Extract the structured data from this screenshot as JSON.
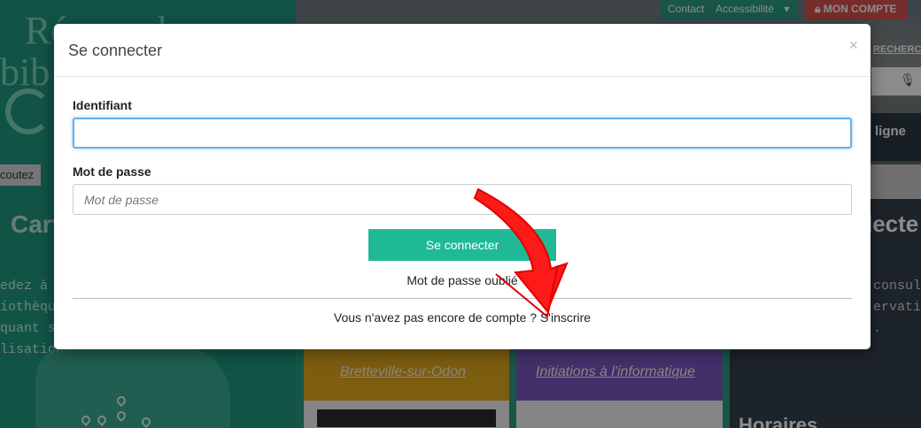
{
  "background": {
    "logo_line1": "Réseau des",
    "logo_line2": "bib",
    "crumb": "coutez",
    "left_card_title": "Cart",
    "left_card_lines": [
      "edez à v",
      "iothèqu",
      "quant su",
      "lisation"
    ],
    "top_links": {
      "contact": "Contact",
      "accessibility": "Accessibilité",
      "caret": "▾"
    },
    "account_label": "MON COMPTE",
    "search_label": "RECHERC",
    "online_label": "ligne",
    "right_card_title": "lecte",
    "right_card_lines": [
      "consult",
      "ervatio",
      "."
    ],
    "tile1_label": "Bretteville-sur-Odon",
    "tile2_label": "Initiations à l'informatique",
    "horaires": "Horaires"
  },
  "modal": {
    "title": "Se connecter",
    "close_glyph": "×",
    "identifiant_label": "Identifiant",
    "identifiant_value": "",
    "password_label": "Mot de passe",
    "password_placeholder": "Mot de passe",
    "login_button": "Se connecter",
    "forgot_link": "Mot de passe oublié",
    "signup_prompt": "Vous n'avez pas encore de compte ?",
    "signup_link": "S'inscrire"
  },
  "colors": {
    "brand_teal": "#20b995",
    "account_red": "#d9534f",
    "annotation_red": "#ff1a1a"
  }
}
